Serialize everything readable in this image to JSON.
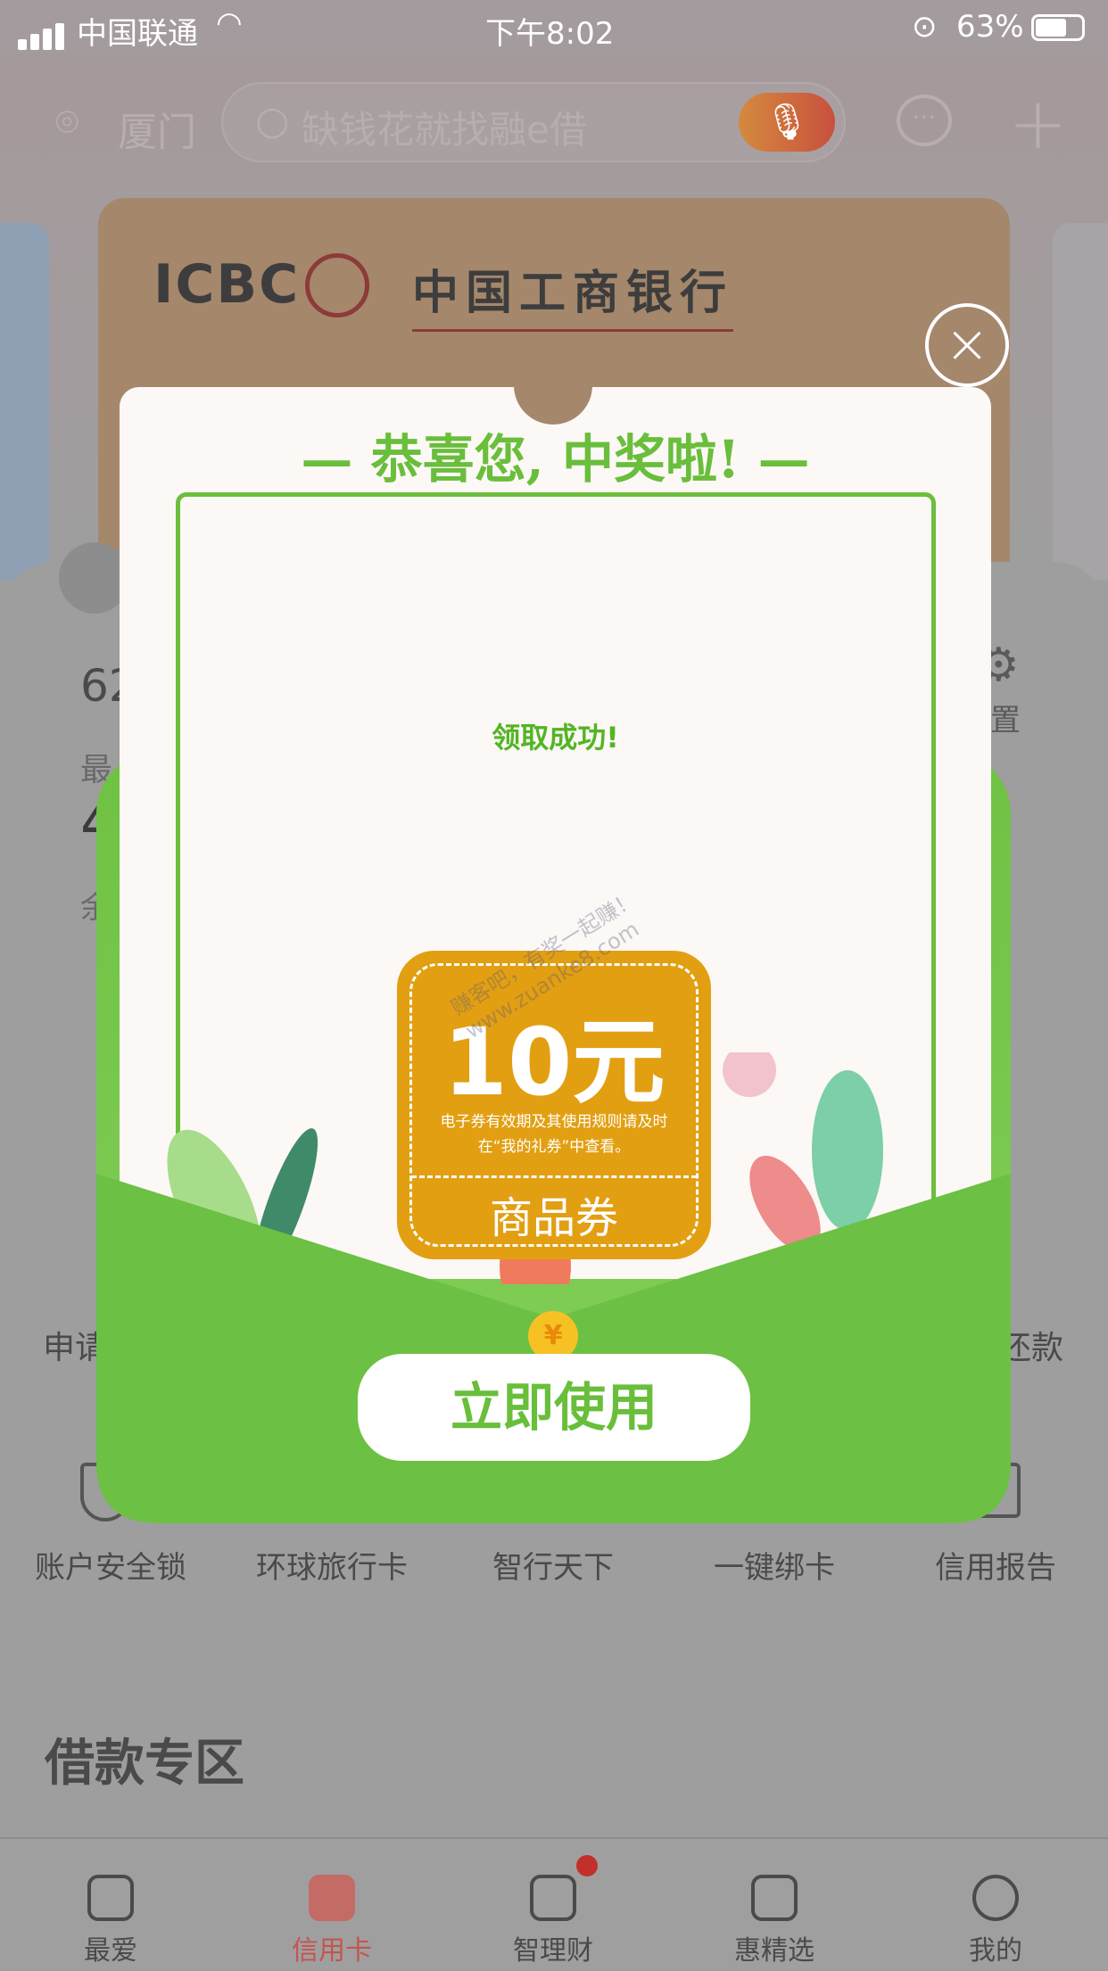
{
  "status_bar": {
    "carrier": "中国联通",
    "time": "下午8:02",
    "battery": "63%"
  },
  "header": {
    "location": "厦门",
    "search_placeholder": "缺钱花就找融e借"
  },
  "card": {
    "brand_en": "ICBC",
    "brand_cn": "中国工商银行"
  },
  "background": {
    "card_number_partial": "62",
    "label_partial_1": "最",
    "amount_partial": "4",
    "label_partial_2": "余",
    "settings_partial": "置",
    "settings_icon": "gear-icon",
    "row1": [
      "申请",
      "还款"
    ],
    "row2": [
      "账户安全锁",
      "环球旅行卡",
      "智行天下",
      "一键绑卡",
      "信用报告"
    ],
    "section_title": "借款专区"
  },
  "tabbar": {
    "active": 1,
    "active_color": "#d0453a",
    "items": [
      {
        "label": "最爱",
        "icon": "home-smile-icon"
      },
      {
        "label": "信用卡",
        "icon": "credit-card-icon"
      },
      {
        "label": "智理财",
        "icon": "chart-icon",
        "badge": true
      },
      {
        "label": "惠精选",
        "icon": "cup-icon"
      },
      {
        "label": "我的",
        "icon": "face-icon"
      }
    ]
  },
  "popup": {
    "title": "— 恭喜您, 中奖啦! —",
    "message": "领取成功!",
    "coupon": {
      "amount": "10元",
      "note_line1": "电子券有效期及其使用规则请及时",
      "note_line2": "在“我的礼券”中查看。",
      "type": "商品券",
      "color": "#e29f12"
    },
    "use_button": "立即使用",
    "coin_symbol": "¥",
    "close_icon": "close-icon",
    "accent": "#69be3b"
  },
  "watermark": {
    "line1": "赚客吧，有奖一起赚！",
    "line2": "www.zuanke8.com"
  }
}
